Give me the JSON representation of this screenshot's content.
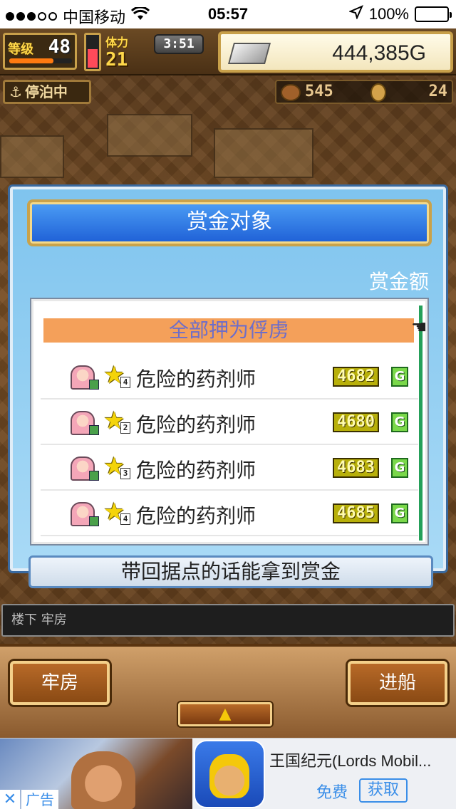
{
  "status_bar": {
    "carrier": "中国移动",
    "time": "05:57",
    "battery": "100%",
    "battery_level": 1.0
  },
  "hud": {
    "level_label": "等级",
    "level": "48",
    "level_progress": 0.7,
    "stamina_gauge": 0.6,
    "stamina_label": "体力",
    "stamina": "21",
    "timer": "3:51",
    "gold": "444,385G",
    "moored_label": "停泊中",
    "food": "545",
    "coins": "24"
  },
  "modal": {
    "title": "赏金对象",
    "bounty_header": "赏金额",
    "capture_all": "全部押为俘虏",
    "hint": "带回据点的话能拿到赏金",
    "rows": [
      {
        "name": "危险的药剂师",
        "star_level": "4",
        "amount": "4682",
        "unit": "G"
      },
      {
        "name": "危险的药剂师",
        "star_level": "2",
        "amount": "4680",
        "unit": "G"
      },
      {
        "name": "危险的药剂师",
        "star_level": "3",
        "amount": "4683",
        "unit": "G"
      },
      {
        "name": "危险的药剂师",
        "star_level": "4",
        "amount": "4685",
        "unit": "G"
      }
    ]
  },
  "location": "楼下 牢房",
  "bottom": {
    "left_button": "牢房",
    "right_button": "进船",
    "up_arrow": "▲"
  },
  "ad": {
    "close": "✕",
    "label": "广告",
    "title": "王国纪元(Lords Mobil...",
    "free": "免费",
    "get": "获取"
  },
  "colors": {
    "modal_bg": "#7fc4ee",
    "title_bg": "#1e5fd6",
    "capture_bg": "#f4a05a",
    "amount_bg": "#b8b00a",
    "accent_link": "#3a8ee8"
  }
}
